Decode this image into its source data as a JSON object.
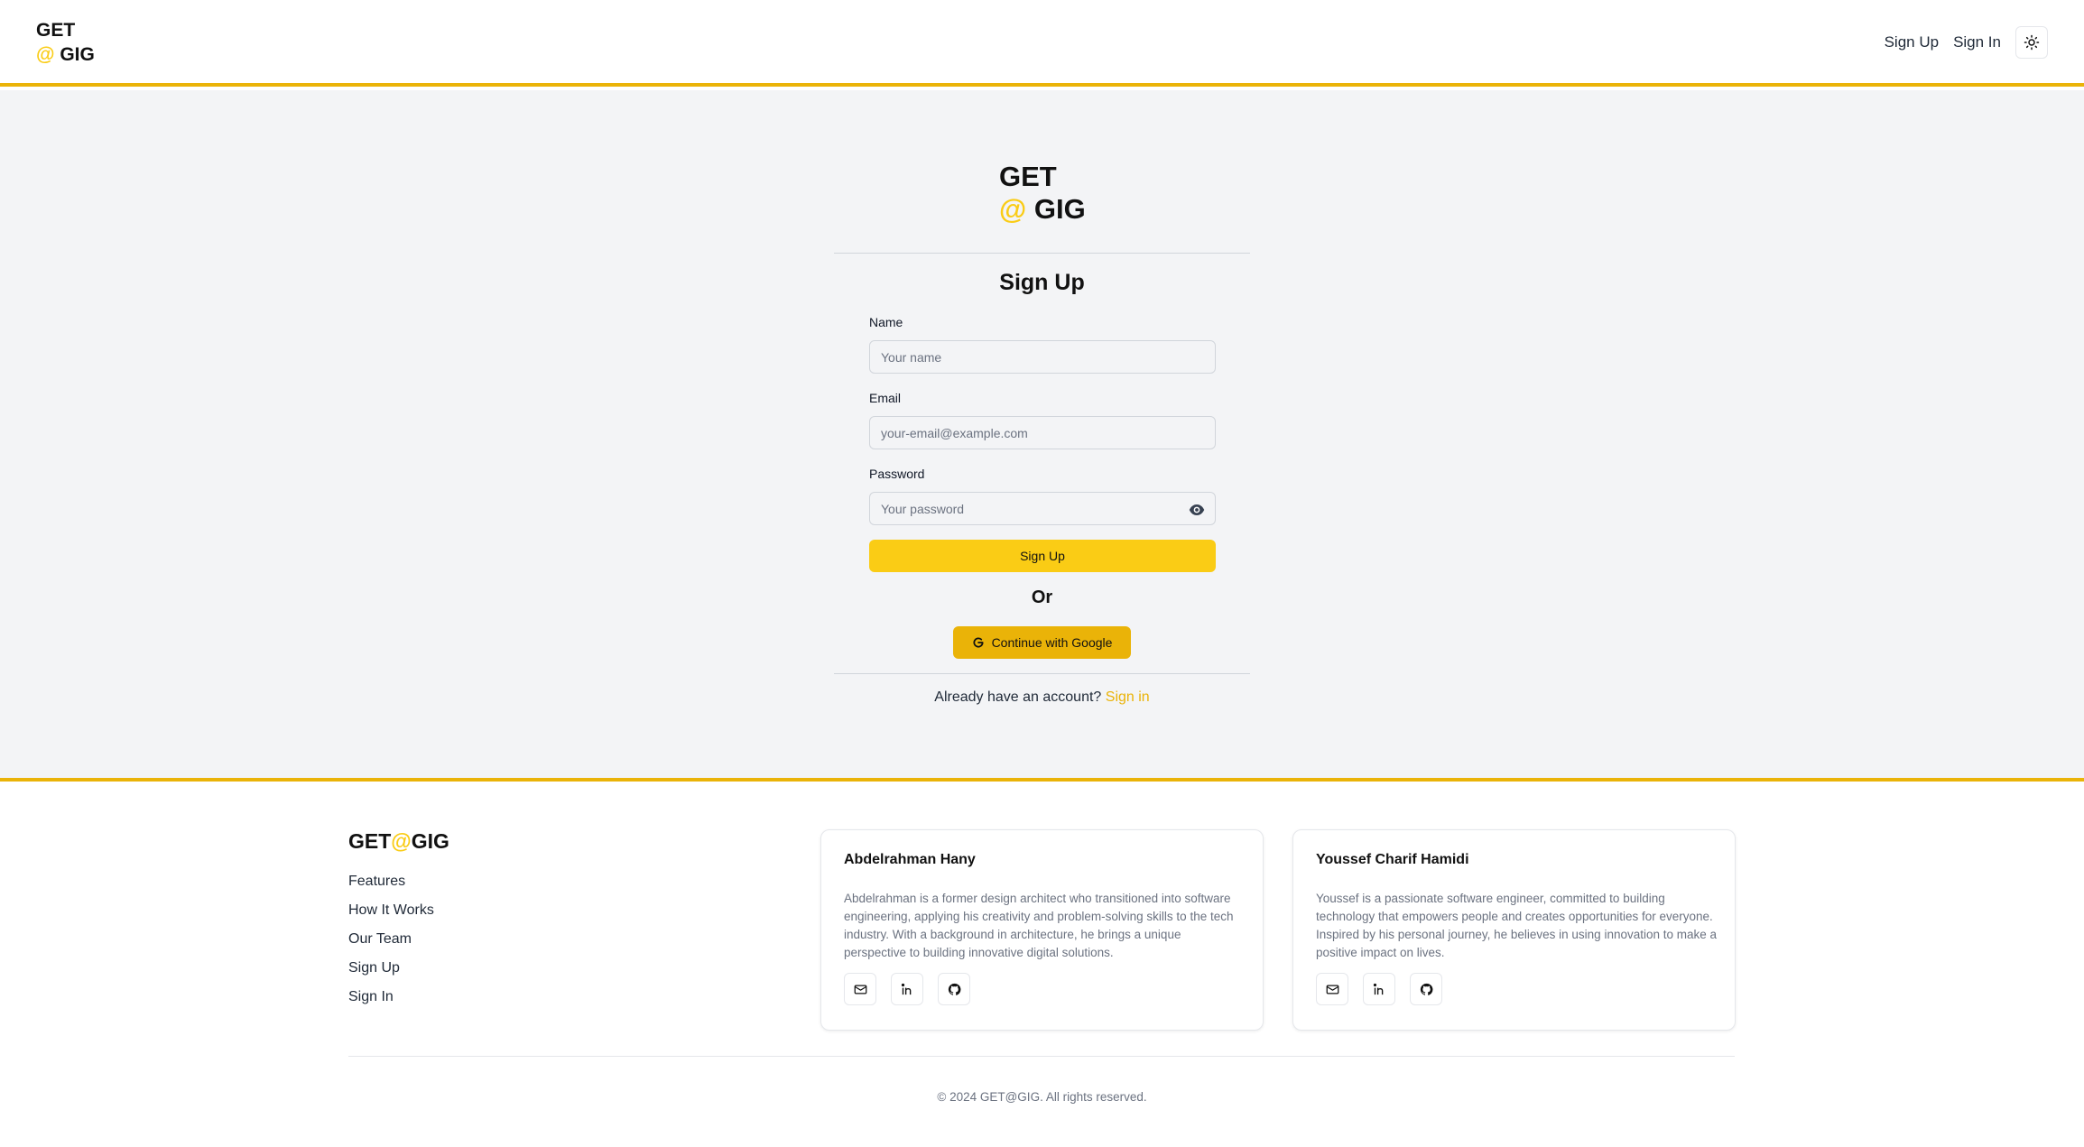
{
  "header": {
    "logo_line1": "GET",
    "logo_at": "@",
    "logo_line2": "GIG",
    "nav": {
      "signup": "Sign Up",
      "signin": "Sign In"
    },
    "theme_icon": "sun-icon"
  },
  "form": {
    "logo_line1": "GET",
    "logo_at": "@",
    "logo_line2": "GIG",
    "title": "Sign Up",
    "fields": {
      "name": {
        "label": "Name",
        "placeholder": "Your name",
        "value": ""
      },
      "email": {
        "label": "Email",
        "placeholder": "your-email@example.com",
        "value": ""
      },
      "password": {
        "label": "Password",
        "placeholder": "Your password",
        "value": "",
        "toggle_icon": "eye-icon"
      }
    },
    "submit_label": "Sign Up",
    "or_text": "Or",
    "google_label": "Continue with Google",
    "google_icon": "google-g-icon",
    "signin_prompt": "Already have an account?",
    "signin_link": "Sign in"
  },
  "footer": {
    "logo_get": "GET",
    "logo_at": "@",
    "logo_gig": "GIG",
    "links": [
      "Features",
      "How It Works",
      "Our Team",
      "Sign Up",
      "Sign In"
    ],
    "team": [
      {
        "name": "Abdelrahman Hany",
        "bio": "Abdelrahman is a former design architect who transitioned into software engineering, applying his creativity and problem-solving skills to the tech industry. With a background in architecture, he brings a unique perspective to building innovative digital solutions.",
        "icons": [
          "mail-icon",
          "linkedin-icon",
          "github-icon"
        ]
      },
      {
        "name": "Youssef Charif Hamidi",
        "bio": "Youssef is a passionate software engineer, committed to building technology that empowers people and creates opportunities for everyone. Inspired by his personal journey, he believes in using innovation to make a positive impact on lives.",
        "icons": [
          "mail-icon",
          "linkedin-icon",
          "github-icon"
        ]
      }
    ],
    "copyright": "© 2024 GET@GIG. All rights reserved."
  },
  "colors": {
    "accent": "#facc15",
    "accent_dark": "#eab308",
    "main_bg": "#f3f4f6"
  }
}
